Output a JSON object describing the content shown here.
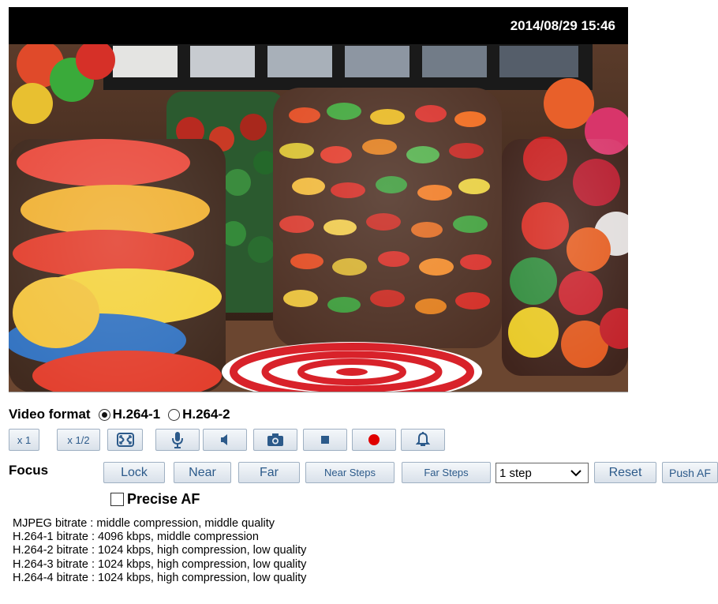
{
  "header": {
    "timestamp": "2014/08/29 15:46"
  },
  "video_format": {
    "label": "Video format",
    "options": [
      {
        "label": "H.264-1",
        "selected": true
      },
      {
        "label": "H.264-2",
        "selected": false
      }
    ]
  },
  "toolbar": {
    "zoom_1": "x 1",
    "zoom_half": "x 1/2",
    "icons": [
      "fit-screen-icon",
      "microphone-icon",
      "speaker-icon",
      "camera-icon",
      "stop-icon",
      "record-icon",
      "alarm-bell-icon"
    ],
    "icon_color": "#2c5a8a",
    "record_color": "#e00000"
  },
  "focus": {
    "label": "Focus",
    "lock": "Lock",
    "near": "Near",
    "far": "Far",
    "near_steps": "Near Steps",
    "far_steps": "Far Steps",
    "step_value": "1 step",
    "reset": "Reset",
    "push_af": "Push AF",
    "precise_af": "Precise AF",
    "precise_checked": false
  },
  "bitrates": [
    "MJPEG bitrate : middle compression, middle quality",
    "H.264-1 bitrate : 4096 kbps, middle compression",
    "H.264-2 bitrate : 1024 kbps, high compression, low quality",
    "H.264-3 bitrate : 1024 kbps, high compression, low quality",
    "H.264-4 bitrate : 1024 kbps, high compression, low quality"
  ]
}
